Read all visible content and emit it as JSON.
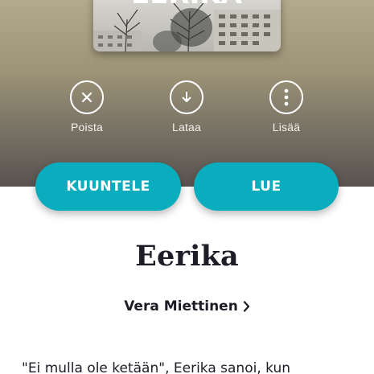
{
  "book": {
    "cover_title": "EERIKA",
    "title": "Eerika",
    "author": "Vera Miettinen"
  },
  "actions": [
    {
      "label": "Poista",
      "icon": "close-icon"
    },
    {
      "label": "Lataa",
      "icon": "download-icon"
    },
    {
      "label": "Lisää",
      "icon": "more-vertical-icon"
    }
  ],
  "buttons": {
    "listen_label": "KUUNTELE",
    "read_label": "LUE"
  },
  "description": {
    "text": "\"Ei mulla ole ketään\", Eerika sanoi, kun"
  },
  "colors": {
    "accent": "#0aadbd",
    "text": "#1d1d28"
  }
}
